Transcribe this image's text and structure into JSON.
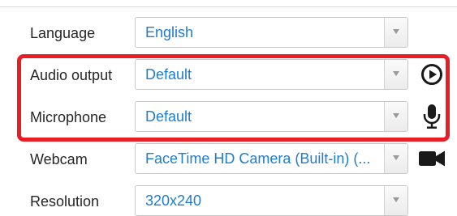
{
  "settings": {
    "rows": [
      {
        "label": "Language",
        "value": "English",
        "icon": null
      },
      {
        "label": "Audio output",
        "value": "Default",
        "icon": "play-circle-icon"
      },
      {
        "label": "Microphone",
        "value": "Default",
        "icon": "microphone-icon"
      },
      {
        "label": "Webcam",
        "value": "FaceTime HD Camera (Built-in) (...",
        "icon": "video-camera-icon"
      },
      {
        "label": "Resolution",
        "value": "320x240",
        "icon": null
      }
    ]
  },
  "colors": {
    "select_text": "#1f7ccf",
    "label_text": "#262626",
    "highlight": "#ea1c24",
    "icon": "#1a1a1a"
  }
}
